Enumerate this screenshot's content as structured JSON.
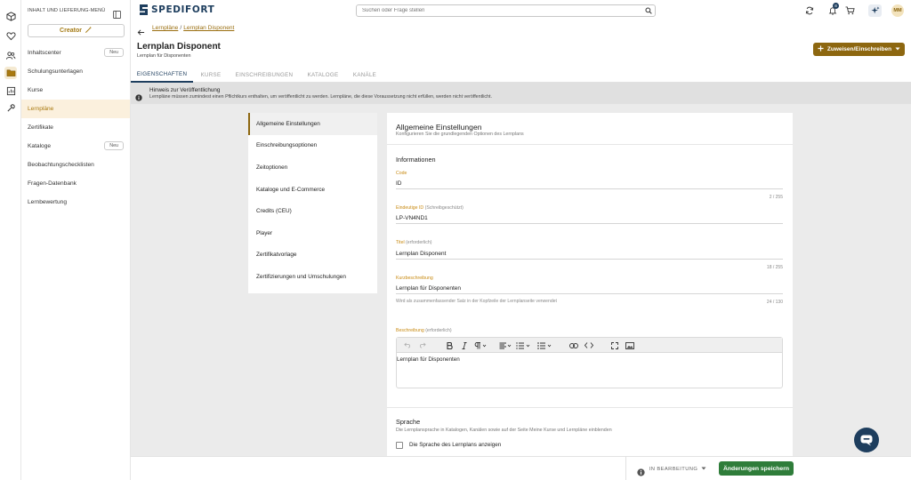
{
  "topbar": {
    "logo_text": "SPEDIFORT",
    "search_placeholder": "Suchen oder Frage stellen",
    "notification_count": "8",
    "avatar_initials": "MM"
  },
  "sidebar": {
    "heading": "INHALT UND LIEFERUNG-MENÜ",
    "creator_label": "Creator",
    "items": [
      {
        "label": "Inhaltscenter",
        "badge": "Neu"
      },
      {
        "label": "Schulungsunterlagen",
        "badge": ""
      },
      {
        "label": "Kurse",
        "badge": ""
      },
      {
        "label": "Lernpläne",
        "badge": ""
      },
      {
        "label": "Zertifikate",
        "badge": ""
      },
      {
        "label": "Kataloge",
        "badge": "Neu"
      },
      {
        "label": "Beobachtungschecklisten",
        "badge": ""
      },
      {
        "label": "Fragen-Datenbank",
        "badge": ""
      },
      {
        "label": "Lernbewertung",
        "badge": ""
      }
    ]
  },
  "header": {
    "breadcrumb": [
      "Lernpläne",
      "Lernplan Disponent"
    ],
    "breadcrumb_sep": "/",
    "title": "Lernplan Disponent",
    "subtitle": "Lernplan für Disponenten",
    "assign_label": "Zuweisen/Einschreiben"
  },
  "tabs": [
    "EIGENSCHAFTEN",
    "KURSE",
    "EINSCHREIBUNGEN",
    "KATALOGE",
    "KANÄLE"
  ],
  "notice": {
    "title": "Hinweis zur Veröffentlichung",
    "text": "Lernpläne müssen zumindest einen Pflichtkurs enthalten, um veröffentlicht zu werden. Lernpläne, die diese Voraussetzung nicht erfüllen, werden nicht veröffentlicht."
  },
  "settings_nav": [
    "Allgemeine Einstellungen",
    "Einschreibungsoptionen",
    "Zeitoptionen",
    "Kataloge und E-Commerce",
    "Credits (CEU)",
    "Player",
    "Zertifikatvorlage",
    "Zertifizierungen und Umschulungen"
  ],
  "form": {
    "title": "Allgemeine Einstellungen",
    "subtitle": "Konfigurieren Sie die grundlegenden Optionen des Lernplans",
    "section_info": "Informationen",
    "code_label": "Code",
    "code_value": "ID",
    "code_count": "2 / 255",
    "uid_label": "Eindeutige ID",
    "uid_note": "(Schreibgeschützt)",
    "uid_value": "LP-VN4ND1",
    "title_label": "Titel",
    "title_note": "(erforderlich)",
    "title_value": "Lernplan Disponent",
    "title_count": "18 / 255",
    "short_label": "Kurzbeschreibung",
    "short_value": "Lernplan für Disponenten",
    "short_help": "Wird als zusammenfassender Satz in der Kopfzeile der Lernplanseite verwendet",
    "short_count": "24 / 130",
    "desc_label": "Beschreibung",
    "desc_note": "(erforderlich)",
    "desc_value": "Lernplan für Disponenten",
    "section_lang": "Sprache",
    "lang_sub": "Die Lernplansprache in Katalogen, Kanälen sowie auf der Seite Meine Kurse und Lernpläne einblenden",
    "lang_checkbox": "Die Sprache des Lernplans anzeigen"
  },
  "footer": {
    "status": "IN BEARBEITUNG",
    "save_label": "Änderungen speichern"
  },
  "colors": {
    "brand_navy": "#1e3e5e",
    "accent_gold": "#8d6710",
    "save_green": "#2f7d3a"
  }
}
